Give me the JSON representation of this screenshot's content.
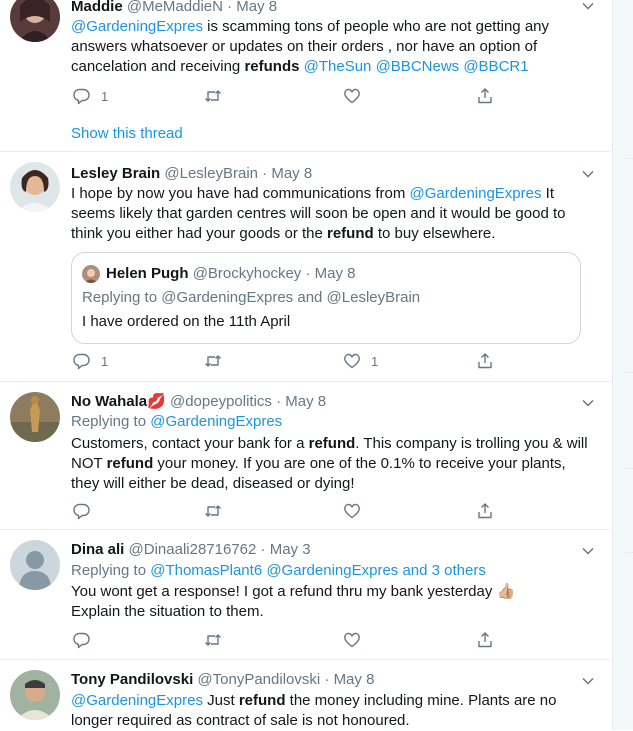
{
  "tweets": [
    {
      "name": "Maddie",
      "handle": "@MeMaddieN",
      "sep": "·",
      "date": "May 8",
      "body": [
        {
          "t": "@GardeningExpres",
          "k": "link"
        },
        {
          "t": " is scamming tons of people who are not getting any answers whatsoever or updates on their orders , nor have an option of cancelation and receiving ",
          "k": "text"
        },
        {
          "t": "refunds",
          "k": "bold"
        },
        {
          "t": " ",
          "k": "text"
        },
        {
          "t": "@TheSun",
          "k": "link"
        },
        {
          "t": " ",
          "k": "text"
        },
        {
          "t": "@BBCNews",
          "k": "link"
        },
        {
          "t": " ",
          "k": "text"
        },
        {
          "t": "@BBCR1",
          "k": "link"
        }
      ],
      "reply_count": "1",
      "retweet_count": "",
      "like_count": "",
      "show_thread": "Show this thread"
    },
    {
      "name": "Lesley Brain",
      "handle": "@LesleyBrain",
      "sep": "·",
      "date": "May 8",
      "body": [
        {
          "t": "I hope by now you have had communications from ",
          "k": "text"
        },
        {
          "t": "@GardeningExpres",
          "k": "link"
        },
        {
          "t": " It seems likely that garden centres will soon be open and it would be good to think you either had your goods or the ",
          "k": "text"
        },
        {
          "t": "refund",
          "k": "bold"
        },
        {
          "t": " to buy elsewhere.",
          "k": "text"
        }
      ],
      "quote": {
        "name": "Helen Pugh",
        "handle": "@Brockyhockey",
        "sep": "·",
        "date": "May 8",
        "replying_label": "Replying to",
        "replying_text": "@GardeningExpres and @LesleyBrain",
        "body": "I have ordered on the 11th April"
      },
      "reply_count": "1",
      "retweet_count": "",
      "like_count": "1"
    },
    {
      "name": "No Wahala💋",
      "handle": "@dopeypolitics",
      "sep": "·",
      "date": "May 8",
      "replying_label": "Replying to",
      "replying_text": "@GardeningExpres",
      "body": [
        {
          "t": "Customers, contact your bank for a ",
          "k": "text"
        },
        {
          "t": "refund",
          "k": "bold"
        },
        {
          "t": ". This company is trolling you & will NOT ",
          "k": "text"
        },
        {
          "t": "refund",
          "k": "bold"
        },
        {
          "t": " your money. If you are one of the 0.1% to receive your plants, they will either be dead, diseased or dying!",
          "k": "text"
        }
      ],
      "reply_count": "",
      "retweet_count": "",
      "like_count": ""
    },
    {
      "name": "Dina ali",
      "handle": "@Dinaali28716762",
      "sep": "·",
      "date": "May 3",
      "replying_label": "Replying to",
      "replying_text": "@ThomasPlant6 @GardeningExpres and 3 others",
      "body": [
        {
          "t": "You wont get a response! I got a refund thru my bank yesterday 👍🏼 Explain the situation to them.",
          "k": "text"
        }
      ],
      "reply_count": "",
      "retweet_count": "",
      "like_count": ""
    },
    {
      "name": "Tony Pandilovski",
      "handle": "@TonyPandilovski",
      "sep": "·",
      "date": "May 8",
      "body": [
        {
          "t": "@GardeningExpres",
          "k": "link"
        },
        {
          "t": " Just ",
          "k": "text"
        },
        {
          "t": "refund",
          "k": "bold"
        },
        {
          "t": " the money including mine. Plants are no longer required as contract of sale is not honoured.",
          "k": "text"
        }
      ]
    }
  ],
  "colors": {
    "link": "#1b95e0",
    "muted": "#657786",
    "text": "#14171a",
    "border": "#e6ecf0"
  },
  "icons": [
    "reply-icon",
    "retweet-icon",
    "like-icon",
    "share-icon",
    "chevron-down-icon"
  ]
}
